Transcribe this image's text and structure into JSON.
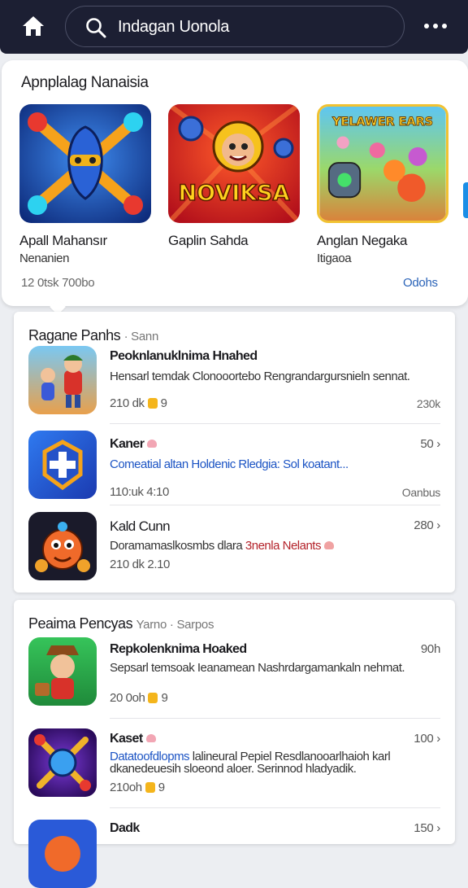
{
  "header": {
    "search_value": "Indagan Uonola"
  },
  "featured": {
    "title": "Apnplalag Nanaisia",
    "apps": [
      {
        "name": "Apall Mahansır",
        "subtitle": "Nenanien",
        "art_text": ""
      },
      {
        "name": "Gaplin Sahda",
        "subtitle": "",
        "art_text": "NOVIKSA"
      },
      {
        "name": "Anglan Negaka",
        "subtitle": "Itigaoa",
        "art_text": "YELAWER EARS"
      }
    ],
    "footer_left": "12 0tsk 700bo",
    "footer_right": "Odohs"
  },
  "section1": {
    "title": "Ragane Panhs",
    "subtitle": "· Sann",
    "rows": [
      {
        "name": "Peoknlanuklnima Hnahed",
        "desc": "Hensarl temdak Clonooortebo Rengrandargursnieln sennat.",
        "meta": "210 dk",
        "meta2": "9",
        "right": "",
        "foot": "230k"
      },
      {
        "name": "Kaner",
        "desc": "Comeatial altan Holdenic Rledgia: Sol koatant...",
        "meta": "110:uk 4:10",
        "meta2": "",
        "right": "50",
        "foot": "Oanbus"
      },
      {
        "name": "Kald Cunn",
        "desc_a": "Doramamaslkosmbs dlara",
        "desc_b": "3nenla Nelants",
        "meta": "210 dk 2.10",
        "meta2": "",
        "right": "280",
        "foot": ""
      }
    ]
  },
  "section2": {
    "title": "Peaima Pencyas",
    "subtitle": "Yarno · Sarpos",
    "rows": [
      {
        "name": "Repkolenknima Hoaked",
        "desc": "Sepsarl temsoak Ieanamean Nashrdargamankaln nehmat.",
        "meta": "20 0oh",
        "meta2": "9",
        "right": "90h",
        "foot": ""
      },
      {
        "name": "Kaset",
        "desc_a": "Datatoofdlopms",
        "desc_b": "lalineural Pepiel Resdlanooarlhaioh karl dkanedeuesih sloeond aloer. Serinnod hladyadik.",
        "meta": "210oh",
        "meta2": "9",
        "right": "100",
        "foot": ""
      },
      {
        "name": "Dadk",
        "desc": "",
        "meta": "",
        "meta2": "",
        "right": "150",
        "foot": ""
      }
    ]
  },
  "colors": {
    "topbar": "#1c1f33",
    "link_blue": "#2a63b8",
    "desc_blue": "#1c54c4",
    "desc_red": "#b4232b"
  }
}
